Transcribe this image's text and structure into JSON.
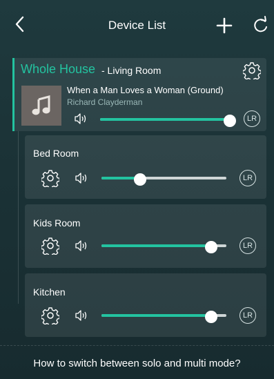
{
  "header": {
    "title": "Device List",
    "back_icon": "chevron-left-icon",
    "add_icon": "plus-icon",
    "refresh_icon": "refresh-icon"
  },
  "master": {
    "group_name": "Whole House",
    "room_label": " - Living Room",
    "song_title": "When a Man Loves a Woman (Ground)",
    "artist": "Richard Clayderman",
    "volume_percent": 100,
    "channel_label": "LR"
  },
  "rooms": [
    {
      "name": "Bed Room",
      "volume_percent": 31,
      "channel_label": "LR"
    },
    {
      "name": "Kids Room",
      "volume_percent": 88,
      "channel_label": "LR"
    },
    {
      "name": "Kitchen",
      "volume_percent": 88,
      "channel_label": "LR"
    }
  ],
  "footer": {
    "help_text": "How to switch between solo and multi mode?"
  },
  "colors": {
    "accent": "#23c3a0",
    "background": "#1d3438"
  }
}
